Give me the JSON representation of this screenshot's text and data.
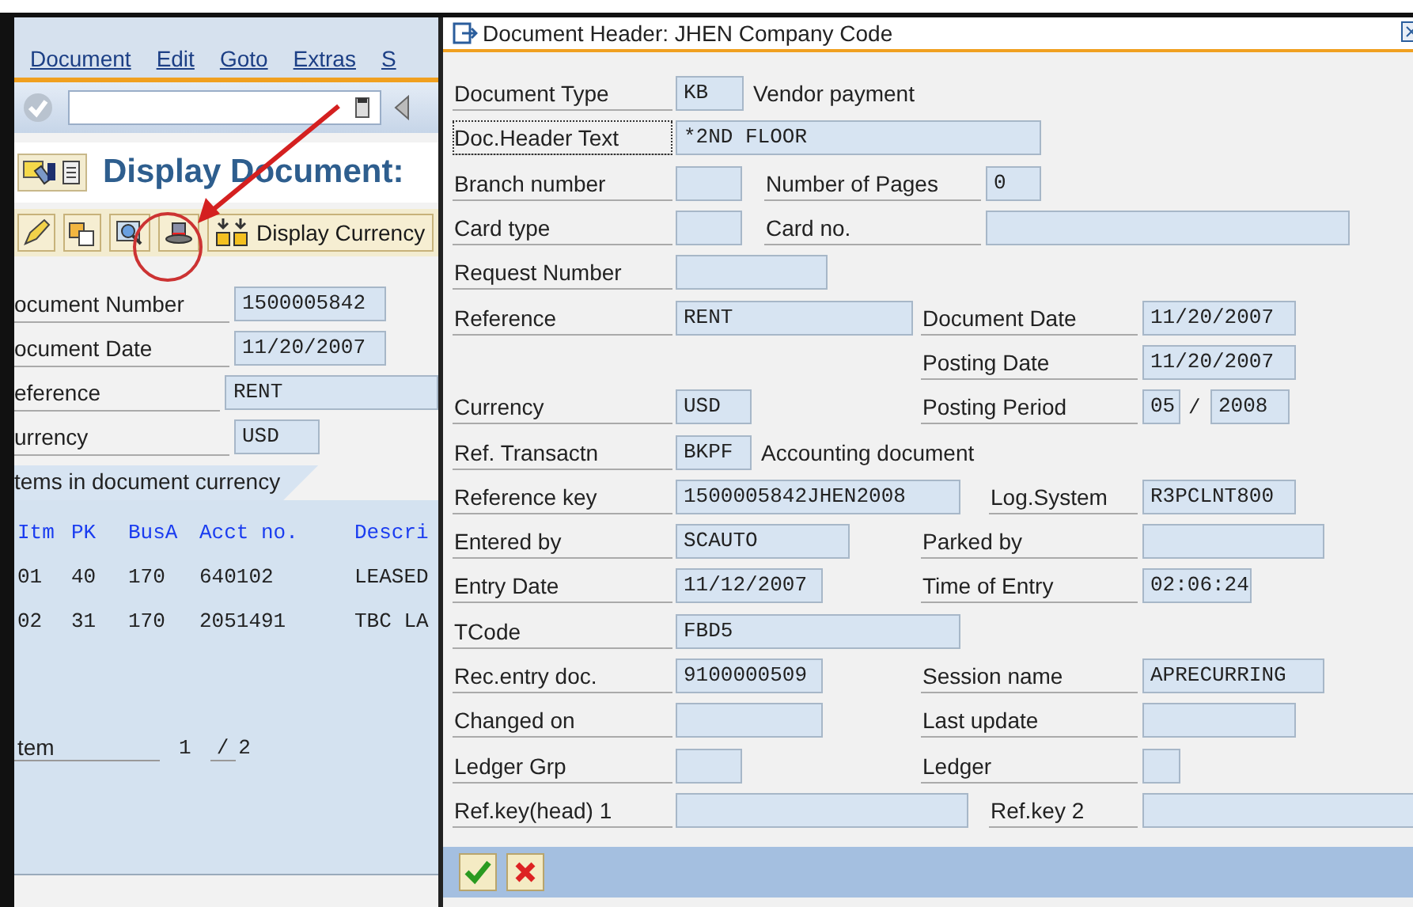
{
  "main_window": {
    "menu": [
      {
        "label": "Document"
      },
      {
        "label": "Edit"
      },
      {
        "label": "Goto"
      },
      {
        "label": "Extras"
      },
      {
        "label": "S"
      }
    ],
    "title": "Display Document:",
    "toolbar_button": "Display Currency",
    "header_fields": [
      {
        "label": "ocument Number",
        "value": "1500005842"
      },
      {
        "label": "ocument Date",
        "value": "11/20/2007"
      },
      {
        "label": "eference",
        "value": "RENT"
      },
      {
        "label": "urrency",
        "value": "USD"
      }
    ],
    "tab": "tems in document currency",
    "table": {
      "columns": [
        "Itm",
        "PK",
        "BusA",
        "Acct no.",
        "Descri"
      ],
      "rows": [
        [
          "01",
          "40",
          "170",
          "640102",
          "LEASED"
        ],
        [
          "02",
          "31",
          "170",
          "2051491",
          "TBC LA"
        ]
      ]
    },
    "item": {
      "label": "tem",
      "value": "1",
      "separator": "/",
      "total": "2"
    }
  },
  "dialog": {
    "title": "Document Header: JHEN Company Code",
    "rows": [
      {
        "label": "Document Type",
        "focused": false,
        "value": "KB",
        "description": "Vendor payment"
      },
      {
        "label": "Doc.Header Text",
        "focused": true,
        "value": "*2ND FLOOR"
      },
      {
        "label": "Branch number",
        "focused": false,
        "second": {
          "label": "Number of Pages",
          "value": "0"
        }
      },
      {
        "label": "Card type",
        "focused": false,
        "second": {
          "label": "Card no."
        }
      },
      {
        "label": "Request Number",
        "focused": false
      },
      {
        "label": "Reference",
        "focused": false,
        "value": "RENT",
        "second": {
          "label": "Document Date",
          "value": "11/20/2007"
        }
      },
      {
        "second": {
          "label": "Posting Date",
          "value": "11/20/2007"
        }
      },
      {
        "label": "Currency",
        "focused": false,
        "value": "USD",
        "second": {
          "label": "Posting Period",
          "value": "05",
          "separator": "/",
          "value2": "2008"
        }
      },
      {
        "label": "Ref. Transactn",
        "focused": false,
        "value": "BKPF",
        "description": "Accounting document"
      },
      {
        "label": "Reference key",
        "focused": false,
        "value": "1500005842JHEN2008",
        "second": {
          "label": "Log.System",
          "value": "R3PCLNT800"
        }
      },
      {
        "label": "Entered by",
        "focused": false,
        "value": "SCAUTO",
        "second": {
          "label": "Parked by"
        }
      },
      {
        "label": "Entry Date",
        "focused": false,
        "value": "11/12/2007",
        "second": {
          "label": "Time of Entry",
          "value": "02:06:24"
        }
      },
      {
        "label": "TCode",
        "focused": false,
        "value": "FBD5"
      },
      {
        "label": "Rec.entry doc.",
        "focused": false,
        "value": "9100000509",
        "second": {
          "label": "Session name",
          "value": "APRECURRING"
        }
      },
      {
        "label": "Changed on",
        "focused": false,
        "second": {
          "label": "Last update"
        }
      },
      {
        "label": "Ledger Grp",
        "focused": false,
        "second": {
          "label": "Ledger"
        }
      },
      {
        "label": "Ref.key(head) 1",
        "focused": false,
        "second": {
          "label": "Ref.key 2"
        }
      }
    ]
  }
}
